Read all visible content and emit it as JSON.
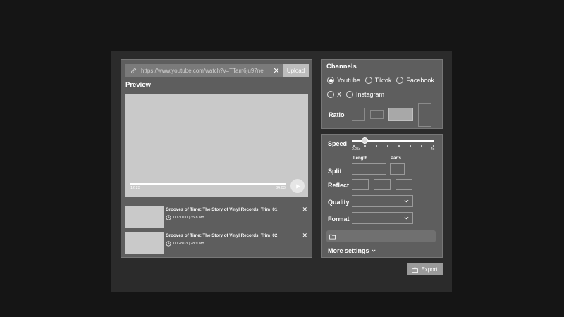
{
  "url_bar": {
    "placeholder": "https://www.youtube.com/watch?v=TTam6ju97ne",
    "clear_icon": "close-icon",
    "upload_label": "Upload"
  },
  "preview": {
    "title": "Preview",
    "time_start": "12:23",
    "time_end": "34:03",
    "progress": 0.0
  },
  "clips": [
    {
      "title": "Grooves of Time: The Story of Vinyl Records_Trim_01",
      "meta": "00:30:00 | 35.8 MB"
    },
    {
      "title": "Grooves of Time: The Story of Vinyl Records_Trim_02",
      "meta": "00:28:03 | 28.9 MB"
    }
  ],
  "channels": {
    "title": "Channels",
    "options": [
      {
        "label": "Youtube",
        "selected": true
      },
      {
        "label": "Tiktok",
        "selected": false
      },
      {
        "label": "Facebook",
        "selected": false
      },
      {
        "label": "X",
        "selected": false
      },
      {
        "label": "Instagram",
        "selected": false
      }
    ],
    "ratio_label": "Ratio",
    "ratio_selected_index": 2
  },
  "settings": {
    "speed_label": "Speed",
    "speed_min": "0.25x",
    "speed_max": "4x",
    "speed_value_fraction": 0.15,
    "length_label": "Length",
    "parts_label": "Parts",
    "split_label": "Split",
    "reflect_label": "Reflect",
    "quality_label": "Quality",
    "format_label": "Format",
    "more_label": "More settings"
  },
  "export_label": "Export",
  "colors": {
    "panel": "#5e5e5e",
    "background": "#2b2b2b",
    "page": "#151515"
  }
}
